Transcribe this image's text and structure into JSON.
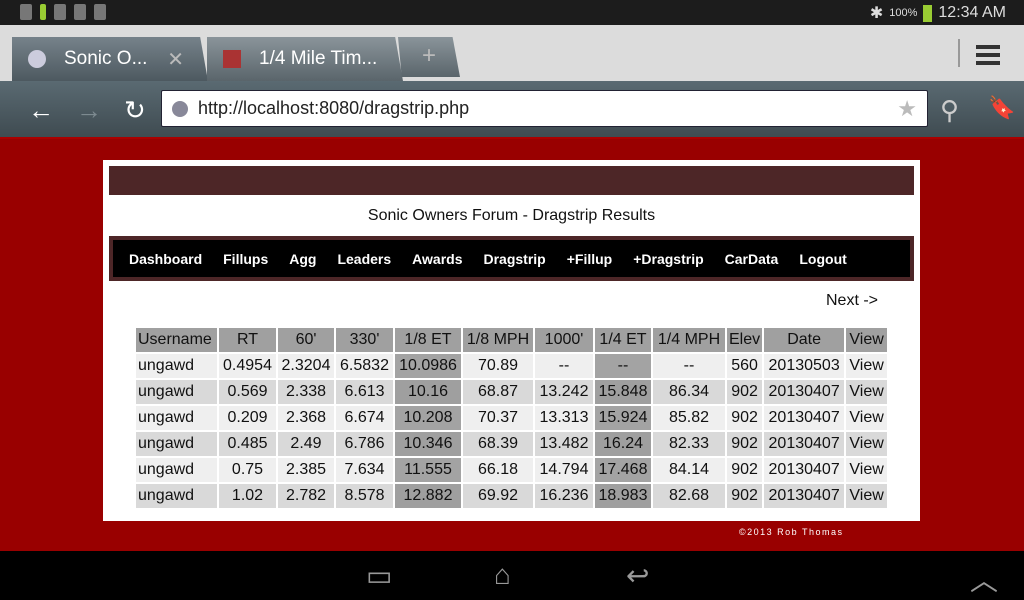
{
  "status": {
    "battery": "100%",
    "time": "12:34 AM"
  },
  "tabs": [
    {
      "label": "Sonic O...",
      "active": true
    },
    {
      "label": "1/4 Mile Tim...",
      "active": false
    }
  ],
  "new_tab": "+",
  "url": "http://localhost:8080/dragstrip.php",
  "page": {
    "title": "Sonic Owners Forum - Dragstrip Results",
    "menu": [
      "Dashboard",
      "Fillups",
      "Agg",
      "Leaders",
      "Awards",
      "Dragstrip",
      "+Fillup",
      "+Dragstrip",
      "CarData",
      "Logout"
    ],
    "next": "Next ->",
    "columns": [
      "Username",
      "RT",
      "60'",
      "330'",
      "1/8 ET",
      "1/8 MPH",
      "1000'",
      "1/4 ET",
      "1/4 MPH",
      "Elev",
      "Date",
      "View"
    ],
    "rows": [
      [
        "ungawd",
        "0.4954",
        "2.3204",
        "6.5832",
        "10.0986",
        "70.89",
        "--",
        "--",
        "--",
        "560",
        "20130503",
        "View"
      ],
      [
        "ungawd",
        "0.569",
        "2.338",
        "6.613",
        "10.16",
        "68.87",
        "13.242",
        "15.848",
        "86.34",
        "902",
        "20130407",
        "View"
      ],
      [
        "ungawd",
        "0.209",
        "2.368",
        "6.674",
        "10.208",
        "70.37",
        "13.313",
        "15.924",
        "85.82",
        "902",
        "20130407",
        "View"
      ],
      [
        "ungawd",
        "0.485",
        "2.49",
        "6.786",
        "10.346",
        "68.39",
        "13.482",
        "16.24",
        "82.33",
        "902",
        "20130407",
        "View"
      ],
      [
        "ungawd",
        "0.75",
        "2.385",
        "7.634",
        "11.555",
        "66.18",
        "14.794",
        "17.468",
        "84.14",
        "902",
        "20130407",
        "View"
      ],
      [
        "ungawd",
        "1.02",
        "2.782",
        "8.578",
        "12.882",
        "69.92",
        "16.236",
        "18.983",
        "82.68",
        "902",
        "20130407",
        "View"
      ]
    ],
    "copyright": "©2013 Rob Thomas"
  },
  "colors": {
    "background": "#990000",
    "header_bar": "#4d2627",
    "menu_bg": "#000000"
  }
}
